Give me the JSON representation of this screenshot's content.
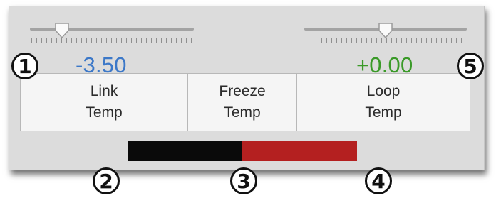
{
  "left_slider": {
    "value": -3.5,
    "display": "-3.50"
  },
  "right_slider": {
    "value": 0.0,
    "display": "+0.00"
  },
  "buttons": [
    {
      "line1": "Link",
      "line2": "Temp"
    },
    {
      "line1": "Freeze",
      "line2": "Temp"
    },
    {
      "line1": "Loop",
      "line2": "Temp"
    }
  ],
  "meter": {
    "colors": {
      "left": "#0a0a0a",
      "right": "#b42020"
    }
  },
  "callouts": [
    "1",
    "2",
    "3",
    "4",
    "5"
  ],
  "colors": {
    "left_value": "#3c78c8",
    "right_value": "#3a9a28"
  }
}
